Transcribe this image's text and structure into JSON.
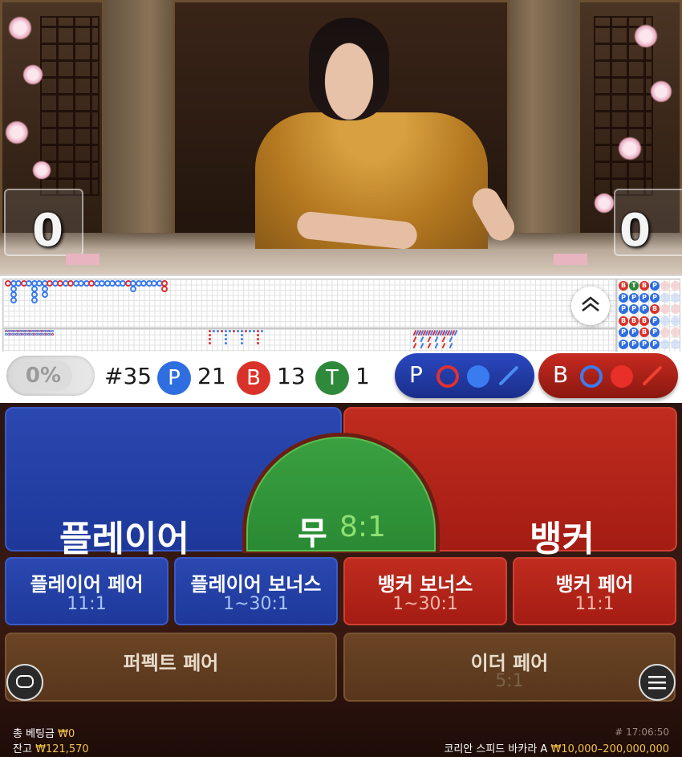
{
  "video": {
    "player_score": "0",
    "banker_score": "0"
  },
  "road": {
    "expand_icon": "chevron-up-icon",
    "bigroad_labels": [
      "B",
      "P",
      "P",
      "B",
      "P",
      "P",
      "T",
      "P",
      "P",
      "B",
      "P",
      "P",
      "B",
      "P",
      "P",
      "B",
      "B",
      "P",
      "P",
      "P",
      "B",
      "P",
      "P",
      "P"
    ]
  },
  "stats": {
    "percent": "0%",
    "round": "#35",
    "player_letter": "P",
    "player_count": "21",
    "banker_letter": "B",
    "banker_count": "13",
    "tie_letter": "T",
    "tie_count": "1",
    "player_predict": "P",
    "banker_predict": "B"
  },
  "bets": {
    "player": "플레이어",
    "tie": "무",
    "tie_odds": "8:1",
    "banker": "뱅커",
    "player_pair": "플레이어 페어",
    "player_pair_odds": "11:1",
    "player_bonus": "플레이어 보너스",
    "player_bonus_odds": "1~30:1",
    "banker_bonus": "뱅커 보너스",
    "banker_bonus_odds": "1~30:1",
    "banker_pair": "뱅커 페어",
    "banker_pair_odds": "11:1",
    "perfect_pair": "퍼펙트 페어",
    "either_pair": "이더 페어",
    "either_pair_odds": "5:1"
  },
  "footer": {
    "total_bet_label": "총 베팅금",
    "total_bet_value": "₩0",
    "balance_label": "잔고",
    "balance_value": "₩121,570",
    "time": "# 17:06:50",
    "table_name": "코리안 스피드 바카라 A",
    "limits": "₩10,000–200,000,000"
  },
  "colors": {
    "player_blue": "#1e389a",
    "banker_red": "#a41c14",
    "tie_green": "#2a8a34",
    "gold": "#f2c24a"
  }
}
